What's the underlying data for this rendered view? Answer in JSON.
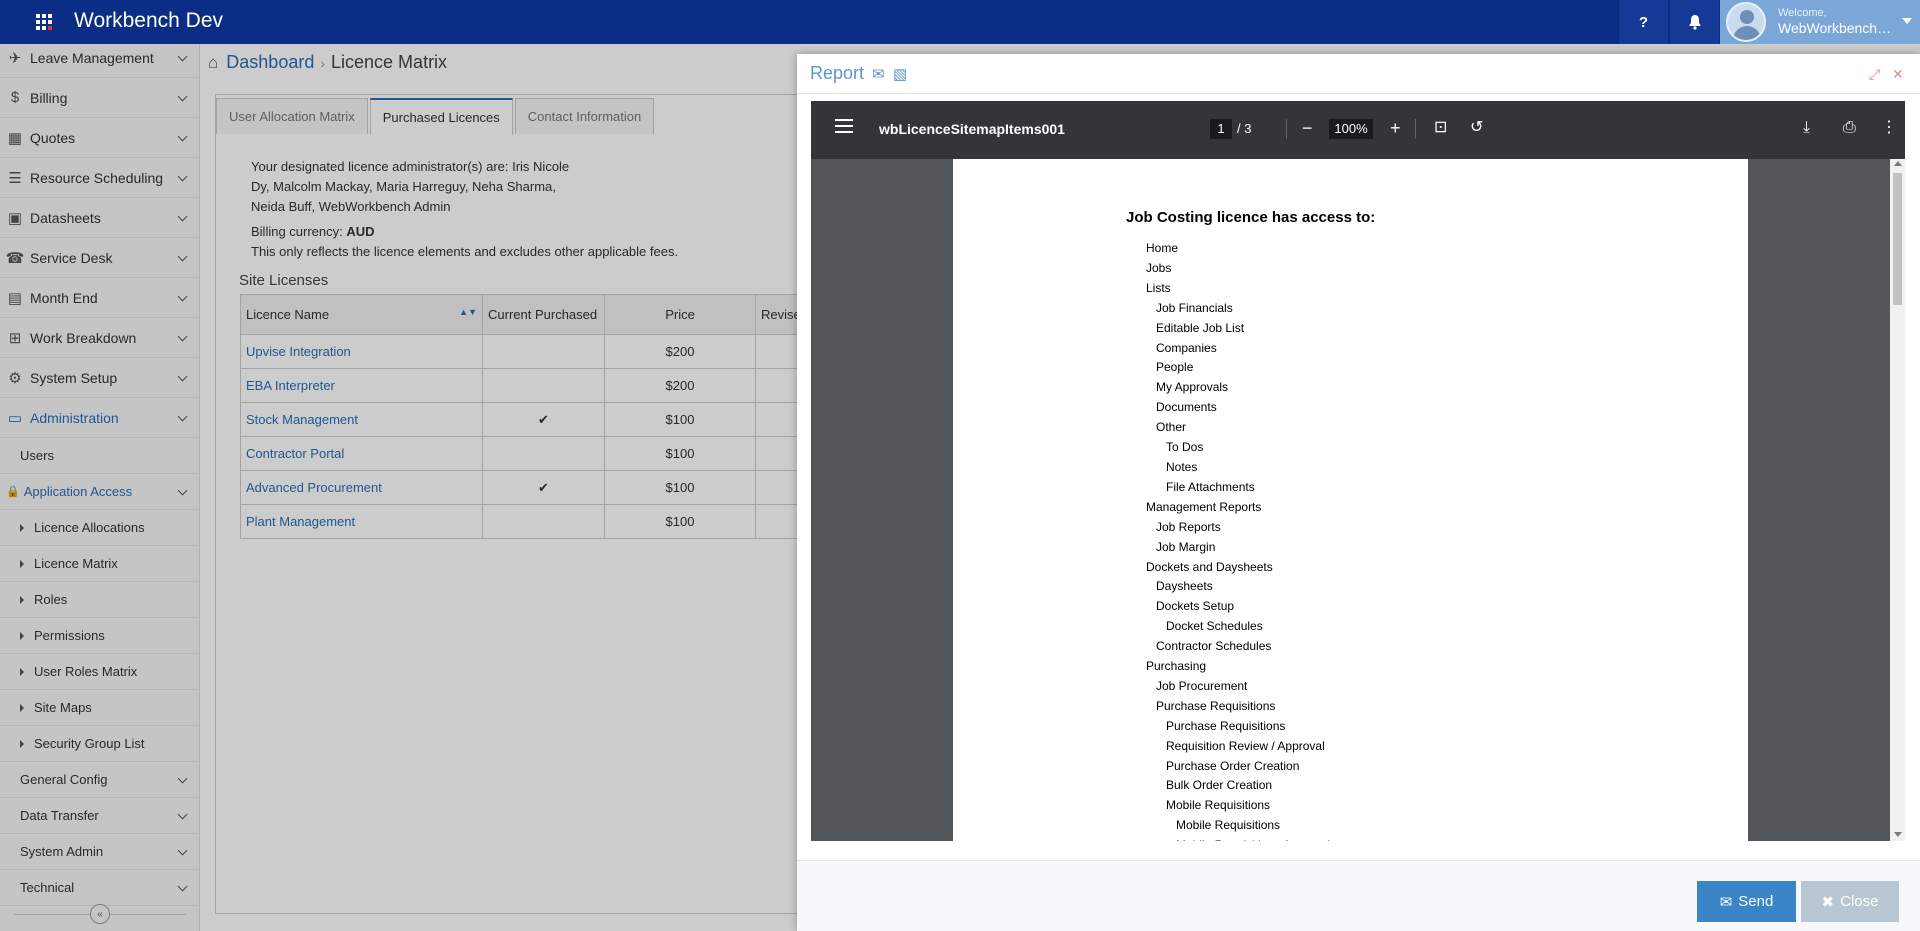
{
  "app": {
    "title": "Workbench Dev",
    "welcome": "Welcome,",
    "user_name": "WebWorkbench Admin",
    "help_label": "?"
  },
  "sidebar": {
    "items": [
      {
        "label": "Leave Management",
        "icon": "plane-icon"
      },
      {
        "label": "Billing",
        "icon": "dollar-icon"
      },
      {
        "label": "Quotes",
        "icon": "grid-icon"
      },
      {
        "label": "Resource Scheduling",
        "icon": "tasks-icon"
      },
      {
        "label": "Datasheets",
        "icon": "calendar-check-icon"
      },
      {
        "label": "Service Desk",
        "icon": "phone-icon"
      },
      {
        "label": "Month End",
        "icon": "calendar-x-icon"
      },
      {
        "label": "Work Breakdown",
        "icon": "sitemap-icon"
      },
      {
        "label": "System Setup",
        "icon": "gears-icon"
      },
      {
        "label": "Administration",
        "icon": "folder-open-icon"
      }
    ],
    "admin_sub": {
      "users": "Users",
      "application_access": "Application Access",
      "access_items": [
        "Licence Allocations",
        "Licence Matrix",
        "Roles",
        "Permissions",
        "User Roles Matrix",
        "Site Maps",
        "Security Group List"
      ],
      "groups": [
        "General Config",
        "Data Transfer",
        "System Admin",
        "Technical"
      ]
    }
  },
  "breadcrumb": {
    "dashboard": "Dashboard",
    "current": "Licence Matrix"
  },
  "tabs": [
    "User Allocation Matrix",
    "Purchased Licences",
    "Contact Information"
  ],
  "info": {
    "administrators": "Your designated licence administrator(s) are: Iris Nicole Dy, Malcolm Mackay, Maria Harreguy, Neha Sharma, Neida Buff, WebWorkbench Admin",
    "currency_label": "Billing currency:",
    "currency": "AUD",
    "note": "This only reflects the licence elements and excludes other applicable fees."
  },
  "site_licenses": {
    "title": "Site Licenses",
    "columns": [
      "Licence Name",
      "Current Purchased",
      "Price",
      "Revise"
    ],
    "rows": [
      {
        "name": "Upvise Integration",
        "purchased": "",
        "price": "$200"
      },
      {
        "name": "EBA Interpreter",
        "purchased": "",
        "price": "$200"
      },
      {
        "name": "Stock Management",
        "purchased": "✔",
        "price": "$100"
      },
      {
        "name": "Contractor Portal",
        "purchased": "",
        "price": "$100"
      },
      {
        "name": "Advanced Procurement",
        "purchased": "✔",
        "price": "$100"
      },
      {
        "name": "Plant Management",
        "purchased": "",
        "price": "$100"
      }
    ]
  },
  "modal": {
    "title": "Report",
    "send": "Send",
    "close": "Close"
  },
  "pdf": {
    "file_name": "wbLicenceSitemapItems001",
    "page": "1",
    "page_total": "/ 3",
    "zoom": "100%",
    "heading": "Job Costing licence has access to:",
    "lines": [
      {
        "text": "Home",
        "level": 1
      },
      {
        "text": "Jobs",
        "level": 1
      },
      {
        "text": "Lists",
        "level": 1
      },
      {
        "text": "Job Financials",
        "level": 2
      },
      {
        "text": "Editable Job List",
        "level": 2
      },
      {
        "text": "Companies",
        "level": 2
      },
      {
        "text": "People",
        "level": 2
      },
      {
        "text": "My Approvals",
        "level": 2
      },
      {
        "text": "Documents",
        "level": 2
      },
      {
        "text": "Other",
        "level": 2
      },
      {
        "text": "To Dos",
        "level": 3
      },
      {
        "text": "Notes",
        "level": 3
      },
      {
        "text": "File Attachments",
        "level": 3
      },
      {
        "text": "Management Reports",
        "level": 1
      },
      {
        "text": "Job Reports",
        "level": 2
      },
      {
        "text": "Job Margin",
        "level": 2
      },
      {
        "text": "Dockets and Daysheets",
        "level": 1
      },
      {
        "text": "Daysheets",
        "level": 2
      },
      {
        "text": "Dockets Setup",
        "level": 2
      },
      {
        "text": "Docket Schedules",
        "level": 3
      },
      {
        "text": "Contractor Schedules",
        "level": 2
      },
      {
        "text": "Purchasing",
        "level": 1
      },
      {
        "text": "Job Procurement",
        "level": 2
      },
      {
        "text": "Purchase Requisitions",
        "level": 2
      },
      {
        "text": "Purchase Requisitions",
        "level": 3
      },
      {
        "text": "Requisition Review / Approval",
        "level": 3
      },
      {
        "text": "Purchase Order Creation",
        "level": 3
      },
      {
        "text": "Bulk Order Creation",
        "level": 3
      },
      {
        "text": "Mobile Requisitions",
        "level": 3
      },
      {
        "text": "Mobile Requisitions",
        "level": 4
      },
      {
        "text": "Mobile Requisitions Approval",
        "level": 4
      }
    ]
  },
  "colors": {
    "topbar": "#0b2d85",
    "accent": "#2a6db5",
    "send_button": "#3a85c7",
    "close_button": "#b9c6d3"
  }
}
